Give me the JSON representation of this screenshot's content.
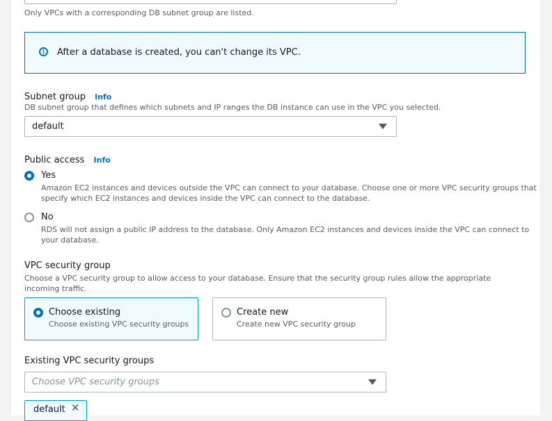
{
  "vpc": {
    "hint": "Only VPCs with a corresponding DB subnet group are listed.",
    "alert_text": "After a database is created, you can't change its VPC."
  },
  "subnet_group": {
    "label": "Subnet group",
    "info": "Info",
    "description": "DB subnet group that defines which subnets and IP ranges the DB instance can use in the VPC you selected.",
    "value": "default"
  },
  "public_access": {
    "label": "Public access",
    "info": "Info",
    "options": [
      {
        "title": "Yes",
        "description_line1": "Amazon EC2 instances and devices outside the VPC can connect to your database. Choose one or more VPC security groups that",
        "description_line2": "specify which EC2 instances and devices inside the VPC can connect to the database.",
        "checked": true
      },
      {
        "title": "No",
        "description_line1": "RDS will not assign a public IP address to the database. Only Amazon EC2 instances and devices inside the VPC can connect to",
        "description_line2": "your database.",
        "checked": false
      }
    ]
  },
  "vpc_security_group": {
    "label": "VPC security group",
    "description_line1": "Choose a VPC security group to allow access to your database. Ensure that the security group rules allow the appropriate",
    "description_line2": "incoming traffic.",
    "tiles": [
      {
        "title": "Choose existing",
        "description": "Choose existing VPC security groups",
        "checked": true
      },
      {
        "title": "Create new",
        "description": "Create new VPC security group",
        "checked": false
      }
    ]
  },
  "existing_groups": {
    "label": "Existing VPC security groups",
    "placeholder": "Choose VPC security groups",
    "token": "default"
  },
  "colors": {
    "accent": "#0073bb",
    "selected_border": "#00a1c9",
    "selected_bg": "#f1faff"
  }
}
